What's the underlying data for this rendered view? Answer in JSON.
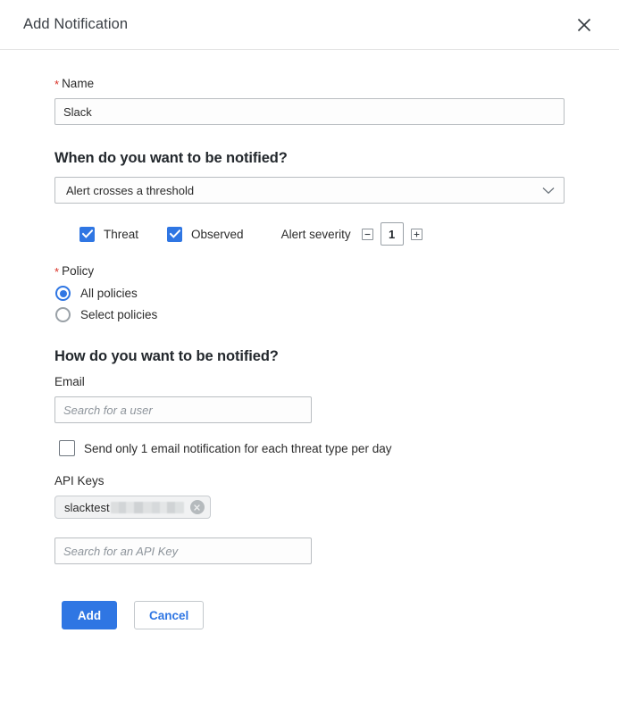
{
  "header": {
    "title": "Add Notification",
    "close_icon": "close-x-icon"
  },
  "name_field": {
    "label": "Name",
    "required_marker": "*",
    "value": "Slack"
  },
  "when_section": {
    "heading": "When do you want to be notified?",
    "trigger_select": {
      "selected": "Alert crosses a threshold",
      "chevron_icon": "chevron-down-icon"
    },
    "threat_checkbox": {
      "label": "Threat",
      "checked": true
    },
    "observed_checkbox": {
      "label": "Observed",
      "checked": true
    },
    "severity": {
      "label": "Alert severity",
      "value": "1",
      "decrement_icon": "minus-icon",
      "increment_icon": "plus-icon"
    }
  },
  "policy_section": {
    "label": "Policy",
    "required_marker": "*",
    "options": [
      {
        "label": "All policies",
        "selected": true
      },
      {
        "label": "Select policies",
        "selected": false
      }
    ]
  },
  "how_section": {
    "heading": "How do you want to be notified?",
    "email_label": "Email",
    "email_placeholder": "Search for a user",
    "email_value": "",
    "daily_digest_checkbox": {
      "label": "Send only 1 email notification for each threat type per day",
      "checked": false
    },
    "api_keys_label": "API Keys",
    "api_key_chip": {
      "text": "slacktest",
      "redacted": true,
      "remove_icon": "remove-circle-icon"
    },
    "api_key_placeholder": "Search for an API Key",
    "api_key_value": ""
  },
  "footer": {
    "submit_label": "Add",
    "cancel_label": "Cancel"
  },
  "colors": {
    "accent": "#2F76E3",
    "required": "#D93025",
    "border": "#B9BDC1",
    "text": "#2B2B2B"
  }
}
